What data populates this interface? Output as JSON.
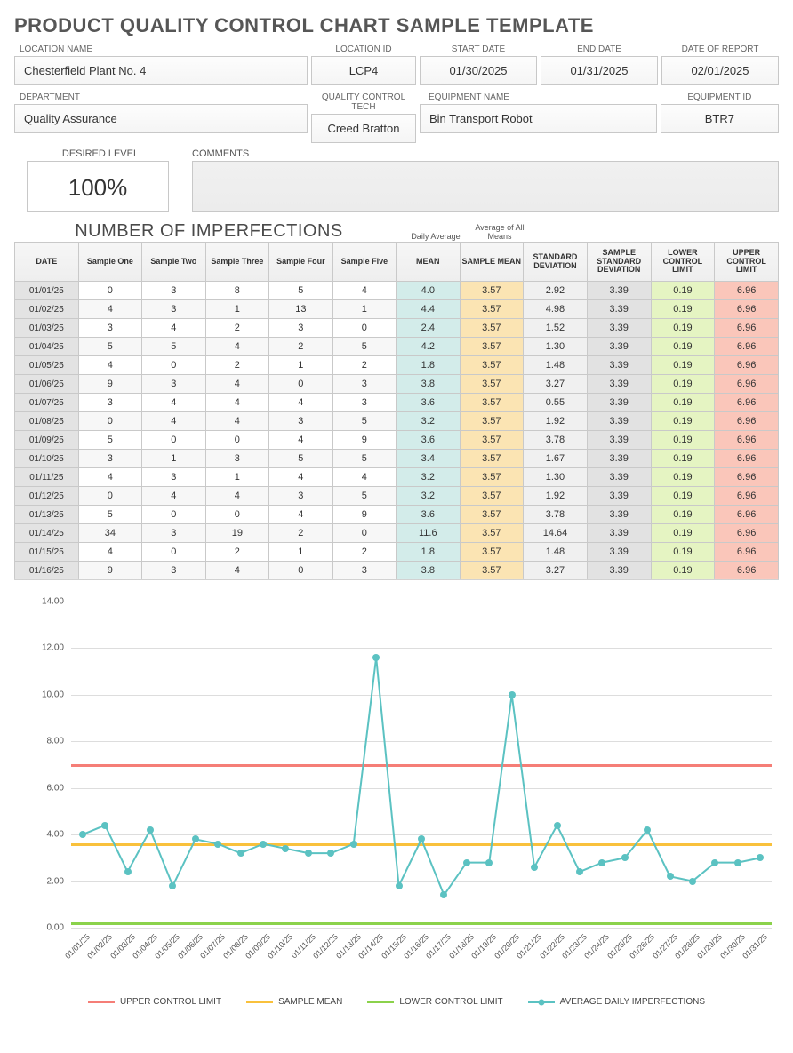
{
  "title": "PRODUCT QUALITY CONTROL CHART SAMPLE TEMPLATE",
  "header": {
    "location_name_label": "LOCATION NAME",
    "location_name": "Chesterfield Plant No. 4",
    "location_id_label": "LOCATION ID",
    "location_id": "LCP4",
    "start_date_label": "START DATE",
    "start_date": "01/30/2025",
    "end_date_label": "END DATE",
    "end_date": "01/31/2025",
    "report_date_label": "DATE OF REPORT",
    "report_date": "02/01/2025",
    "department_label": "DEPARTMENT",
    "department": "Quality Assurance",
    "qc_tech_label": "QUALITY CONTROL TECH",
    "qc_tech": "Creed Bratton",
    "equipment_name_label": "EQUIPMENT NAME",
    "equipment_name": "Bin Transport Robot",
    "equipment_id_label": "EQUIPMENT ID",
    "equipment_id": "BTR7"
  },
  "desired": {
    "label": "DESIRED LEVEL",
    "value": "100%"
  },
  "comments": {
    "label": "COMMENTS",
    "value": ""
  },
  "section_title": "NUMBER OF IMPERFECTIONS",
  "subcaptions": {
    "daily_avg": "Daily\nAverage",
    "avg_means": "Average of\nAll Means"
  },
  "columns": {
    "date": "DATE",
    "s1": "Sample\nOne",
    "s2": "Sample\nTwo",
    "s3": "Sample\nThree",
    "s4": "Sample\nFour",
    "s5": "Sample\nFive",
    "mean": "MEAN",
    "smean": "SAMPLE\nMEAN",
    "sd": "STANDARD\nDEVIATION",
    "ssd": "SAMPLE\nSTANDARD\nDEVIATION",
    "lcl": "LOWER\nCONTROL\nLIMIT",
    "ucl": "UPPER\nCONTROL\nLIMIT"
  },
  "rows": [
    {
      "date": "01/01/25",
      "s": [
        0,
        3,
        8,
        5,
        4
      ],
      "mean": "4.0",
      "sd": "2.92"
    },
    {
      "date": "01/02/25",
      "s": [
        4,
        3,
        1,
        13,
        1
      ],
      "mean": "4.4",
      "sd": "4.98"
    },
    {
      "date": "01/03/25",
      "s": [
        3,
        4,
        2,
        3,
        0
      ],
      "mean": "2.4",
      "sd": "1.52"
    },
    {
      "date": "01/04/25",
      "s": [
        5,
        5,
        4,
        2,
        5
      ],
      "mean": "4.2",
      "sd": "1.30"
    },
    {
      "date": "01/05/25",
      "s": [
        4,
        0,
        2,
        1,
        2
      ],
      "mean": "1.8",
      "sd": "1.48"
    },
    {
      "date": "01/06/25",
      "s": [
        9,
        3,
        4,
        0,
        3
      ],
      "mean": "3.8",
      "sd": "3.27"
    },
    {
      "date": "01/07/25",
      "s": [
        3,
        4,
        4,
        4,
        3
      ],
      "mean": "3.6",
      "sd": "0.55"
    },
    {
      "date": "01/08/25",
      "s": [
        0,
        4,
        4,
        3,
        5
      ],
      "mean": "3.2",
      "sd": "1.92"
    },
    {
      "date": "01/09/25",
      "s": [
        5,
        0,
        0,
        4,
        9
      ],
      "mean": "3.6",
      "sd": "3.78"
    },
    {
      "date": "01/10/25",
      "s": [
        3,
        1,
        3,
        5,
        5
      ],
      "mean": "3.4",
      "sd": "1.67"
    },
    {
      "date": "01/11/25",
      "s": [
        4,
        3,
        1,
        4,
        4
      ],
      "mean": "3.2",
      "sd": "1.30"
    },
    {
      "date": "01/12/25",
      "s": [
        0,
        4,
        4,
        3,
        5
      ],
      "mean": "3.2",
      "sd": "1.92"
    },
    {
      "date": "01/13/25",
      "s": [
        5,
        0,
        0,
        4,
        9
      ],
      "mean": "3.6",
      "sd": "3.78"
    },
    {
      "date": "01/14/25",
      "s": [
        34,
        3,
        19,
        2,
        0
      ],
      "mean": "11.6",
      "sd": "14.64"
    },
    {
      "date": "01/15/25",
      "s": [
        4,
        0,
        2,
        1,
        2
      ],
      "mean": "1.8",
      "sd": "1.48"
    },
    {
      "date": "01/16/25",
      "s": [
        9,
        3,
        4,
        0,
        3
      ],
      "mean": "3.8",
      "sd": "3.27"
    }
  ],
  "constants": {
    "smean": "3.57",
    "ssd": "3.39",
    "lcl": "0.19",
    "ucl": "6.96"
  },
  "legend": {
    "ucl": "UPPER CONTROL LIMIT",
    "smean": "SAMPLE MEAN",
    "lcl": "LOWER CONTROL LIMIT",
    "avg": "AVERAGE DAILY IMPERFECTIONS"
  },
  "chart_data": {
    "type": "line",
    "title": "",
    "xlabel": "",
    "ylabel": "",
    "ylim": [
      0,
      14
    ],
    "yticks": [
      0,
      2,
      4,
      6,
      8,
      10,
      12,
      14
    ],
    "ytick_labels": [
      "0.00",
      "2.00",
      "4.00",
      "6.00",
      "8.00",
      "10.00",
      "12.00",
      "14.00"
    ],
    "categories": [
      "01/01/25",
      "01/02/25",
      "01/03/25",
      "01/04/25",
      "01/05/25",
      "01/06/25",
      "01/07/25",
      "01/08/25",
      "01/09/25",
      "01/10/25",
      "01/11/25",
      "01/12/25",
      "01/13/25",
      "01/14/25",
      "01/15/25",
      "01/16/25",
      "01/17/25",
      "01/18/25",
      "01/19/25",
      "01/20/25",
      "01/21/25",
      "01/22/25",
      "01/23/25",
      "01/24/25",
      "01/25/25",
      "01/26/25",
      "01/27/25",
      "01/28/25",
      "01/29/25",
      "01/30/25",
      "01/31/25"
    ],
    "series": [
      {
        "name": "UPPER CONTROL LIMIT",
        "values": [
          6.96,
          6.96,
          6.96,
          6.96,
          6.96,
          6.96,
          6.96,
          6.96,
          6.96,
          6.96,
          6.96,
          6.96,
          6.96,
          6.96,
          6.96,
          6.96,
          6.96,
          6.96,
          6.96,
          6.96,
          6.96,
          6.96,
          6.96,
          6.96,
          6.96,
          6.96,
          6.96,
          6.96,
          6.96,
          6.96,
          6.96
        ],
        "color": "#f57e77",
        "style": "line-thick"
      },
      {
        "name": "SAMPLE MEAN",
        "values": [
          3.57,
          3.57,
          3.57,
          3.57,
          3.57,
          3.57,
          3.57,
          3.57,
          3.57,
          3.57,
          3.57,
          3.57,
          3.57,
          3.57,
          3.57,
          3.57,
          3.57,
          3.57,
          3.57,
          3.57,
          3.57,
          3.57,
          3.57,
          3.57,
          3.57,
          3.57,
          3.57,
          3.57,
          3.57,
          3.57,
          3.57
        ],
        "color": "#f9c13c",
        "style": "line-thick"
      },
      {
        "name": "LOWER CONTROL LIMIT",
        "values": [
          0.19,
          0.19,
          0.19,
          0.19,
          0.19,
          0.19,
          0.19,
          0.19,
          0.19,
          0.19,
          0.19,
          0.19,
          0.19,
          0.19,
          0.19,
          0.19,
          0.19,
          0.19,
          0.19,
          0.19,
          0.19,
          0.19,
          0.19,
          0.19,
          0.19,
          0.19,
          0.19,
          0.19,
          0.19,
          0.19,
          0.19
        ],
        "color": "#8bd24b",
        "style": "line-thick"
      },
      {
        "name": "AVERAGE DAILY IMPERFECTIONS",
        "values": [
          4.0,
          4.4,
          2.4,
          4.2,
          1.8,
          3.8,
          3.6,
          3.2,
          3.6,
          3.4,
          3.2,
          3.2,
          3.6,
          11.6,
          1.8,
          3.8,
          1.4,
          2.8,
          2.8,
          10.0,
          2.6,
          4.4,
          2.4,
          2.8,
          3.0,
          4.2,
          2.2,
          2.0,
          2.8,
          2.8,
          3.0
        ],
        "color": "#5bc2c2",
        "style": "line-markers"
      }
    ]
  }
}
